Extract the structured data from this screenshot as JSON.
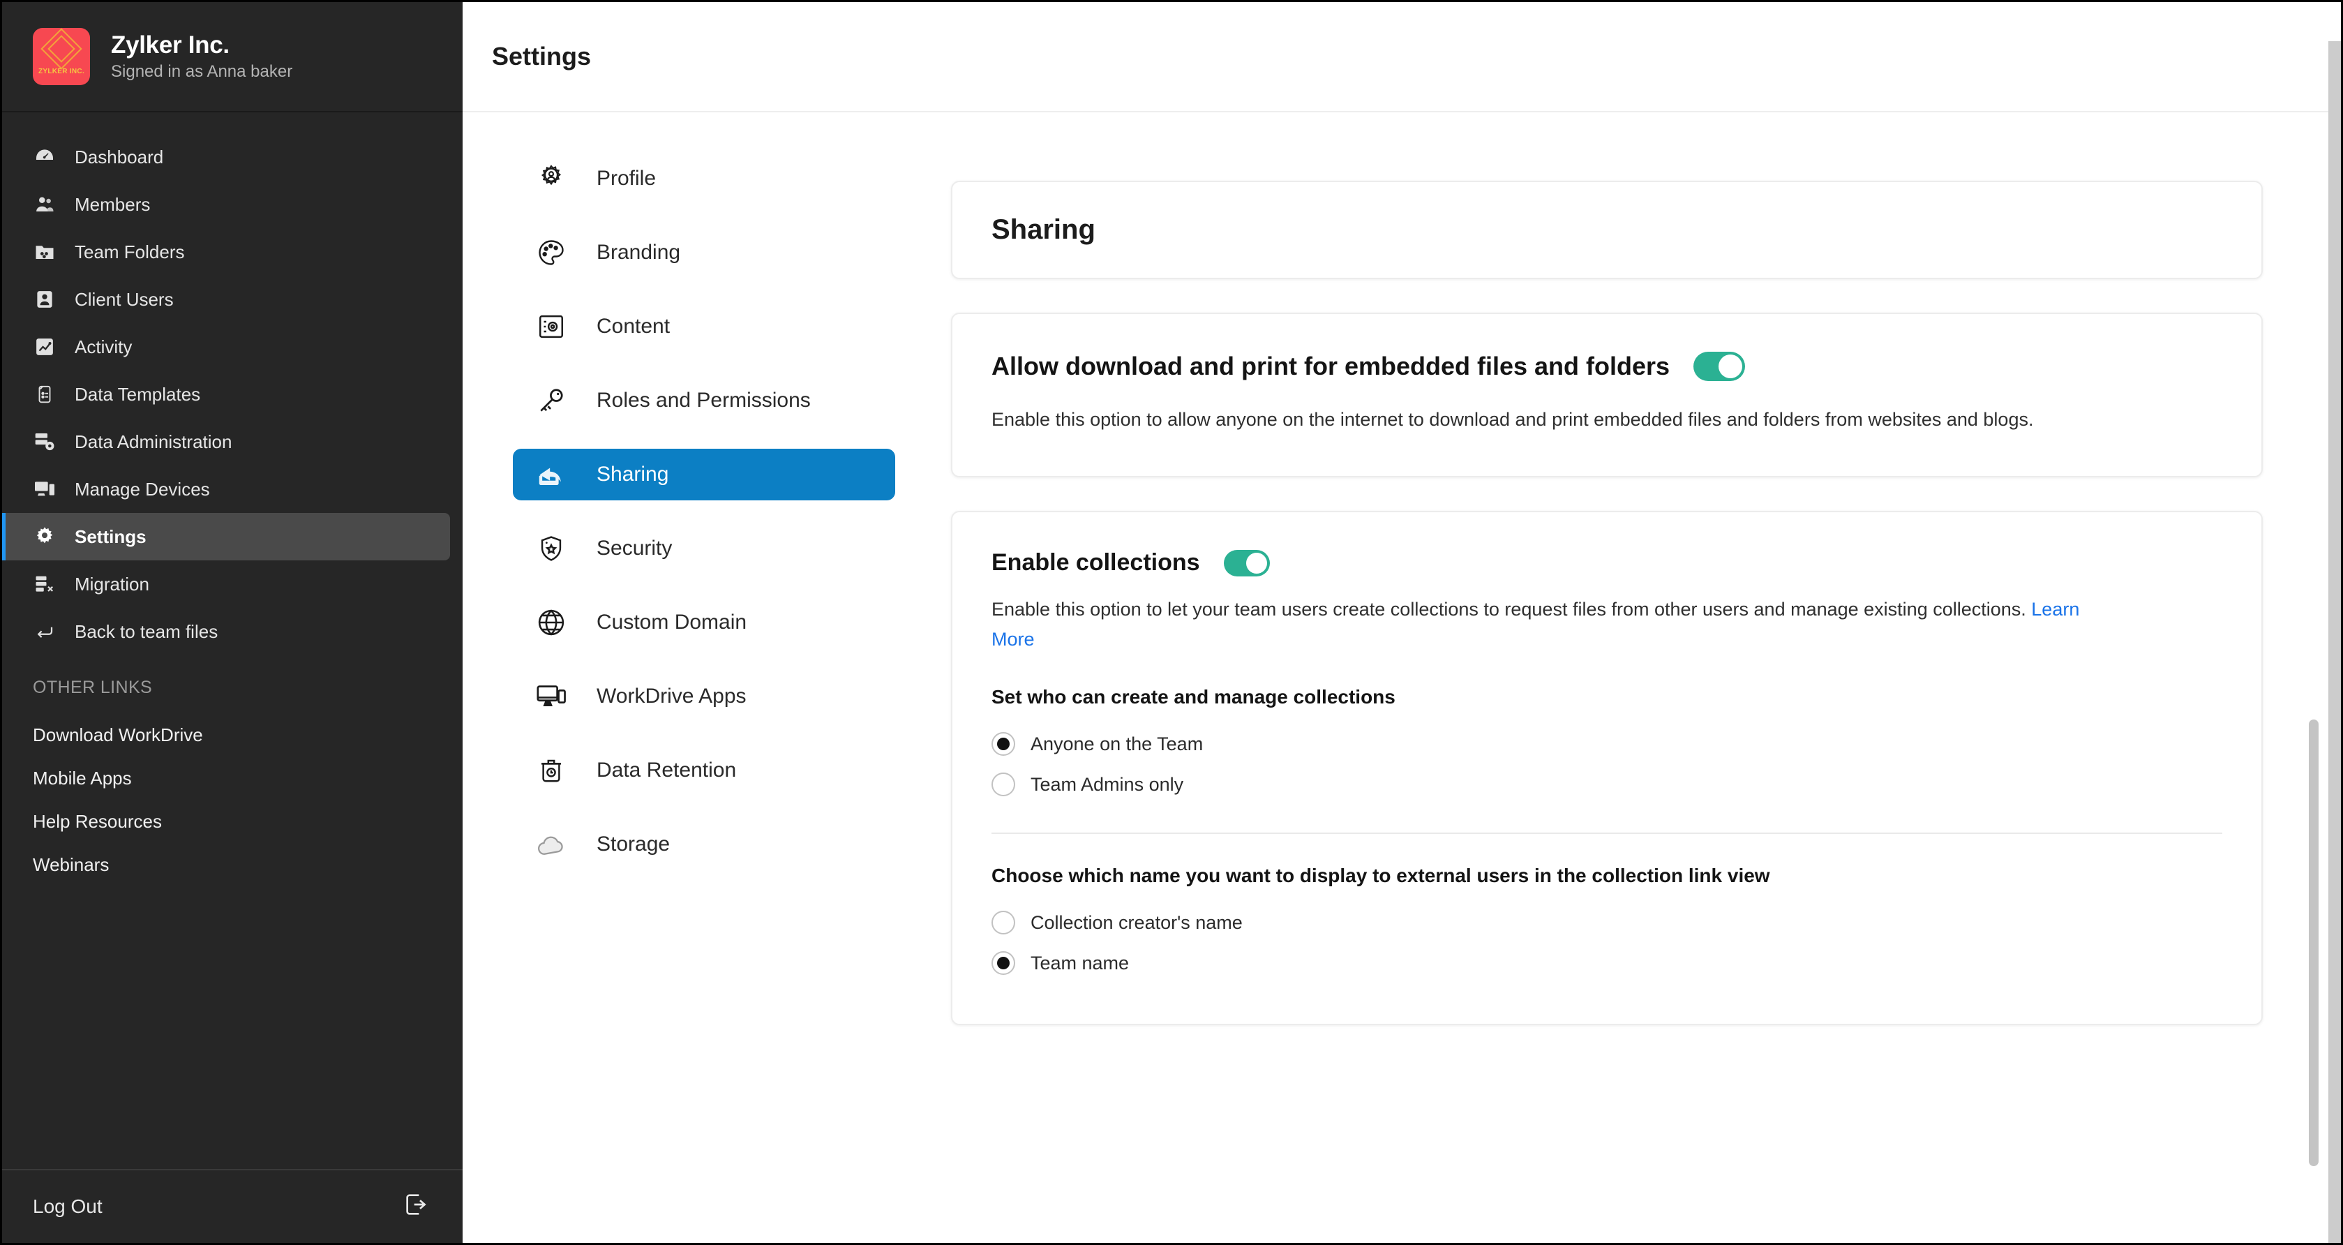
{
  "brand": {
    "name": "Zylker Inc.",
    "signed_in_as": "Signed in as Anna baker",
    "logo_text": "ZYLKER INC."
  },
  "sidebar": {
    "nav_items": [
      {
        "label": "Dashboard",
        "icon": "dashboard-icon",
        "active": false
      },
      {
        "label": "Members",
        "icon": "members-icon",
        "active": false
      },
      {
        "label": "Team Folders",
        "icon": "team-folders-icon",
        "active": false
      },
      {
        "label": "Client Users",
        "icon": "client-users-icon",
        "active": false
      },
      {
        "label": "Activity",
        "icon": "activity-icon",
        "active": false
      },
      {
        "label": "Data Templates",
        "icon": "data-templates-icon",
        "active": false
      },
      {
        "label": "Data Administration",
        "icon": "data-administration-icon",
        "active": false
      },
      {
        "label": "Manage Devices",
        "icon": "manage-devices-icon",
        "active": false
      },
      {
        "label": "Settings",
        "icon": "settings-gear-icon",
        "active": true
      },
      {
        "label": "Migration",
        "icon": "migration-icon",
        "active": false
      },
      {
        "label": "Back to team files",
        "icon": "back-arrow-icon",
        "active": false
      }
    ],
    "other_links_heading": "OTHER LINKS",
    "other_links": [
      {
        "label": "Download WorkDrive"
      },
      {
        "label": "Mobile Apps"
      },
      {
        "label": "Help Resources"
      },
      {
        "label": "Webinars"
      }
    ],
    "logout_label": "Log Out",
    "logout_icon": "logout-icon"
  },
  "topbar": {
    "title": "Settings"
  },
  "settings_nav": {
    "items": [
      {
        "label": "Profile",
        "icon": "profile-gear-icon",
        "selected": false
      },
      {
        "label": "Branding",
        "icon": "palette-icon",
        "selected": false
      },
      {
        "label": "Content",
        "icon": "safe-box-icon",
        "selected": false
      },
      {
        "label": "Roles and Permissions",
        "icon": "key-icon",
        "selected": false
      },
      {
        "label": "Sharing",
        "icon": "share-icon",
        "selected": true
      },
      {
        "label": "Security",
        "icon": "shield-star-icon",
        "selected": false
      },
      {
        "label": "Custom Domain",
        "icon": "globe-icon",
        "selected": false
      },
      {
        "label": "WorkDrive Apps",
        "icon": "devices-icon",
        "selected": false
      },
      {
        "label": "Data Retention",
        "icon": "trash-clock-icon",
        "selected": false
      },
      {
        "label": "Storage",
        "icon": "cloud-icon",
        "selected": false
      }
    ]
  },
  "content": {
    "page_card_title": "Sharing",
    "download_print": {
      "title": "Allow download and print for embedded files and folders",
      "toggle_on": true,
      "toggle_color": "#2BB193",
      "description": "Enable this option to allow anyone on the internet to download and print embedded files and folders from websites and blogs."
    },
    "collections": {
      "title": "Enable collections",
      "toggle_on": true,
      "toggle_color": "#2BB193",
      "description_text": "Enable this option to let your team users create collections to request files from other users and manage existing collections. ",
      "learn_more_label": "Learn More",
      "learn_more_color": "#1a73e8",
      "manage_heading": "Set who can create and manage collections",
      "manage_options": [
        {
          "label": "Anyone on the Team",
          "selected": true
        },
        {
          "label": "Team Admins only",
          "selected": false
        }
      ],
      "display_name_heading": "Choose which name you want to display to external users in the collection link view",
      "display_name_options": [
        {
          "label": "Collection creator's name",
          "selected": false
        },
        {
          "label": "Team name",
          "selected": true
        }
      ]
    }
  },
  "colors": {
    "sidebar_bg": "#262626",
    "sidebar_active_bg": "#4a4a4a",
    "sidebar_active_accent": "#2196f3",
    "subnav_selected_bg": "#0c7fc4",
    "brand_red": "#f74851",
    "toggle_green": "#2BB193",
    "link_blue": "#1a73e8"
  }
}
